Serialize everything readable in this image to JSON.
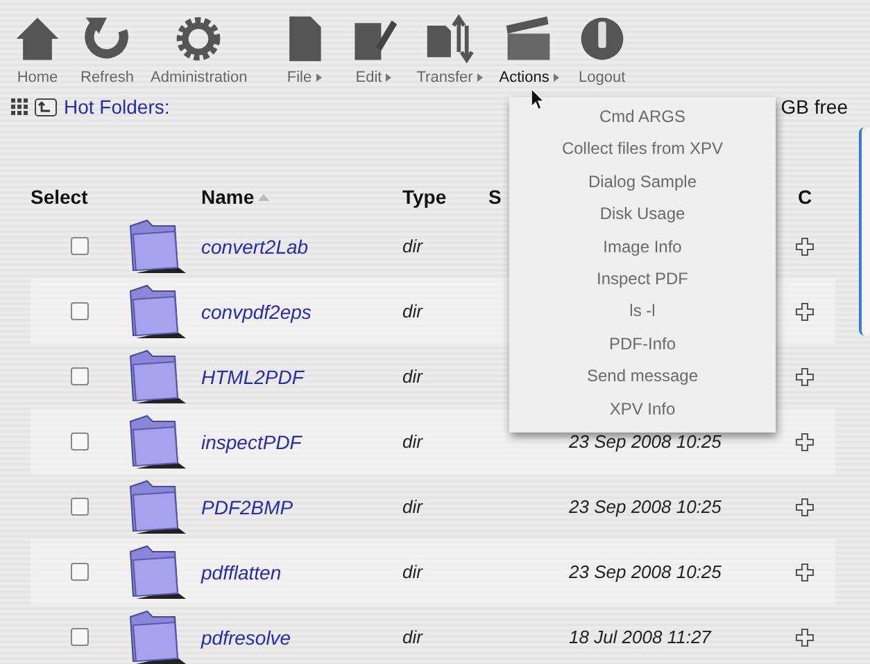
{
  "toolbar": [
    {
      "label": "Home",
      "kind": "home",
      "submenu": false,
      "selected": false
    },
    {
      "label": "Refresh",
      "kind": "refresh",
      "submenu": false,
      "selected": false
    },
    {
      "label": "Administration",
      "kind": "gear",
      "submenu": false,
      "selected": false
    },
    {
      "label": "File",
      "kind": "file",
      "submenu": true,
      "selected": false
    },
    {
      "label": "Edit",
      "kind": "edit",
      "submenu": true,
      "selected": false
    },
    {
      "label": "Transfer",
      "kind": "transfer",
      "submenu": true,
      "selected": false
    },
    {
      "label": "Actions",
      "kind": "actions",
      "submenu": true,
      "selected": true
    },
    {
      "label": "Logout",
      "kind": "logout",
      "submenu": false,
      "selected": false
    }
  ],
  "location": {
    "title": "Hot Folders:",
    "free_space": "GB free"
  },
  "table": {
    "columns": {
      "select": "Select",
      "name": "Name",
      "type": "Type",
      "column_4": "S",
      "column_6": "C"
    },
    "rows": [
      {
        "name": "convert2Lab",
        "type": "dir",
        "checked": false
      },
      {
        "name": "convpdf2eps",
        "type": "dir",
        "checked": false
      },
      {
        "name": "HTML2PDF",
        "type": "dir",
        "checked": false
      },
      {
        "name": "inspectPDF",
        "type": "dir",
        "date": "23 Sep 2008 10:25",
        "checked": false
      },
      {
        "name": "PDF2BMP",
        "type": "dir",
        "date": "23 Sep 2008 10:25",
        "checked": false
      },
      {
        "name": "pdfflatten",
        "type": "dir",
        "date": "23 Sep 2008 10:25",
        "checked": false
      },
      {
        "name": "pdfresolve",
        "type": "dir",
        "date": "18 Jul 2008 11:27",
        "checked": false
      }
    ]
  },
  "actions_menu": [
    "Cmd ARGS",
    "Collect files from XPV",
    "Dialog Sample",
    "Disk Usage",
    "Image Info",
    "Inspect PDF",
    "ls -l",
    "PDF-Info",
    "Send message",
    "XPV Info"
  ]
}
